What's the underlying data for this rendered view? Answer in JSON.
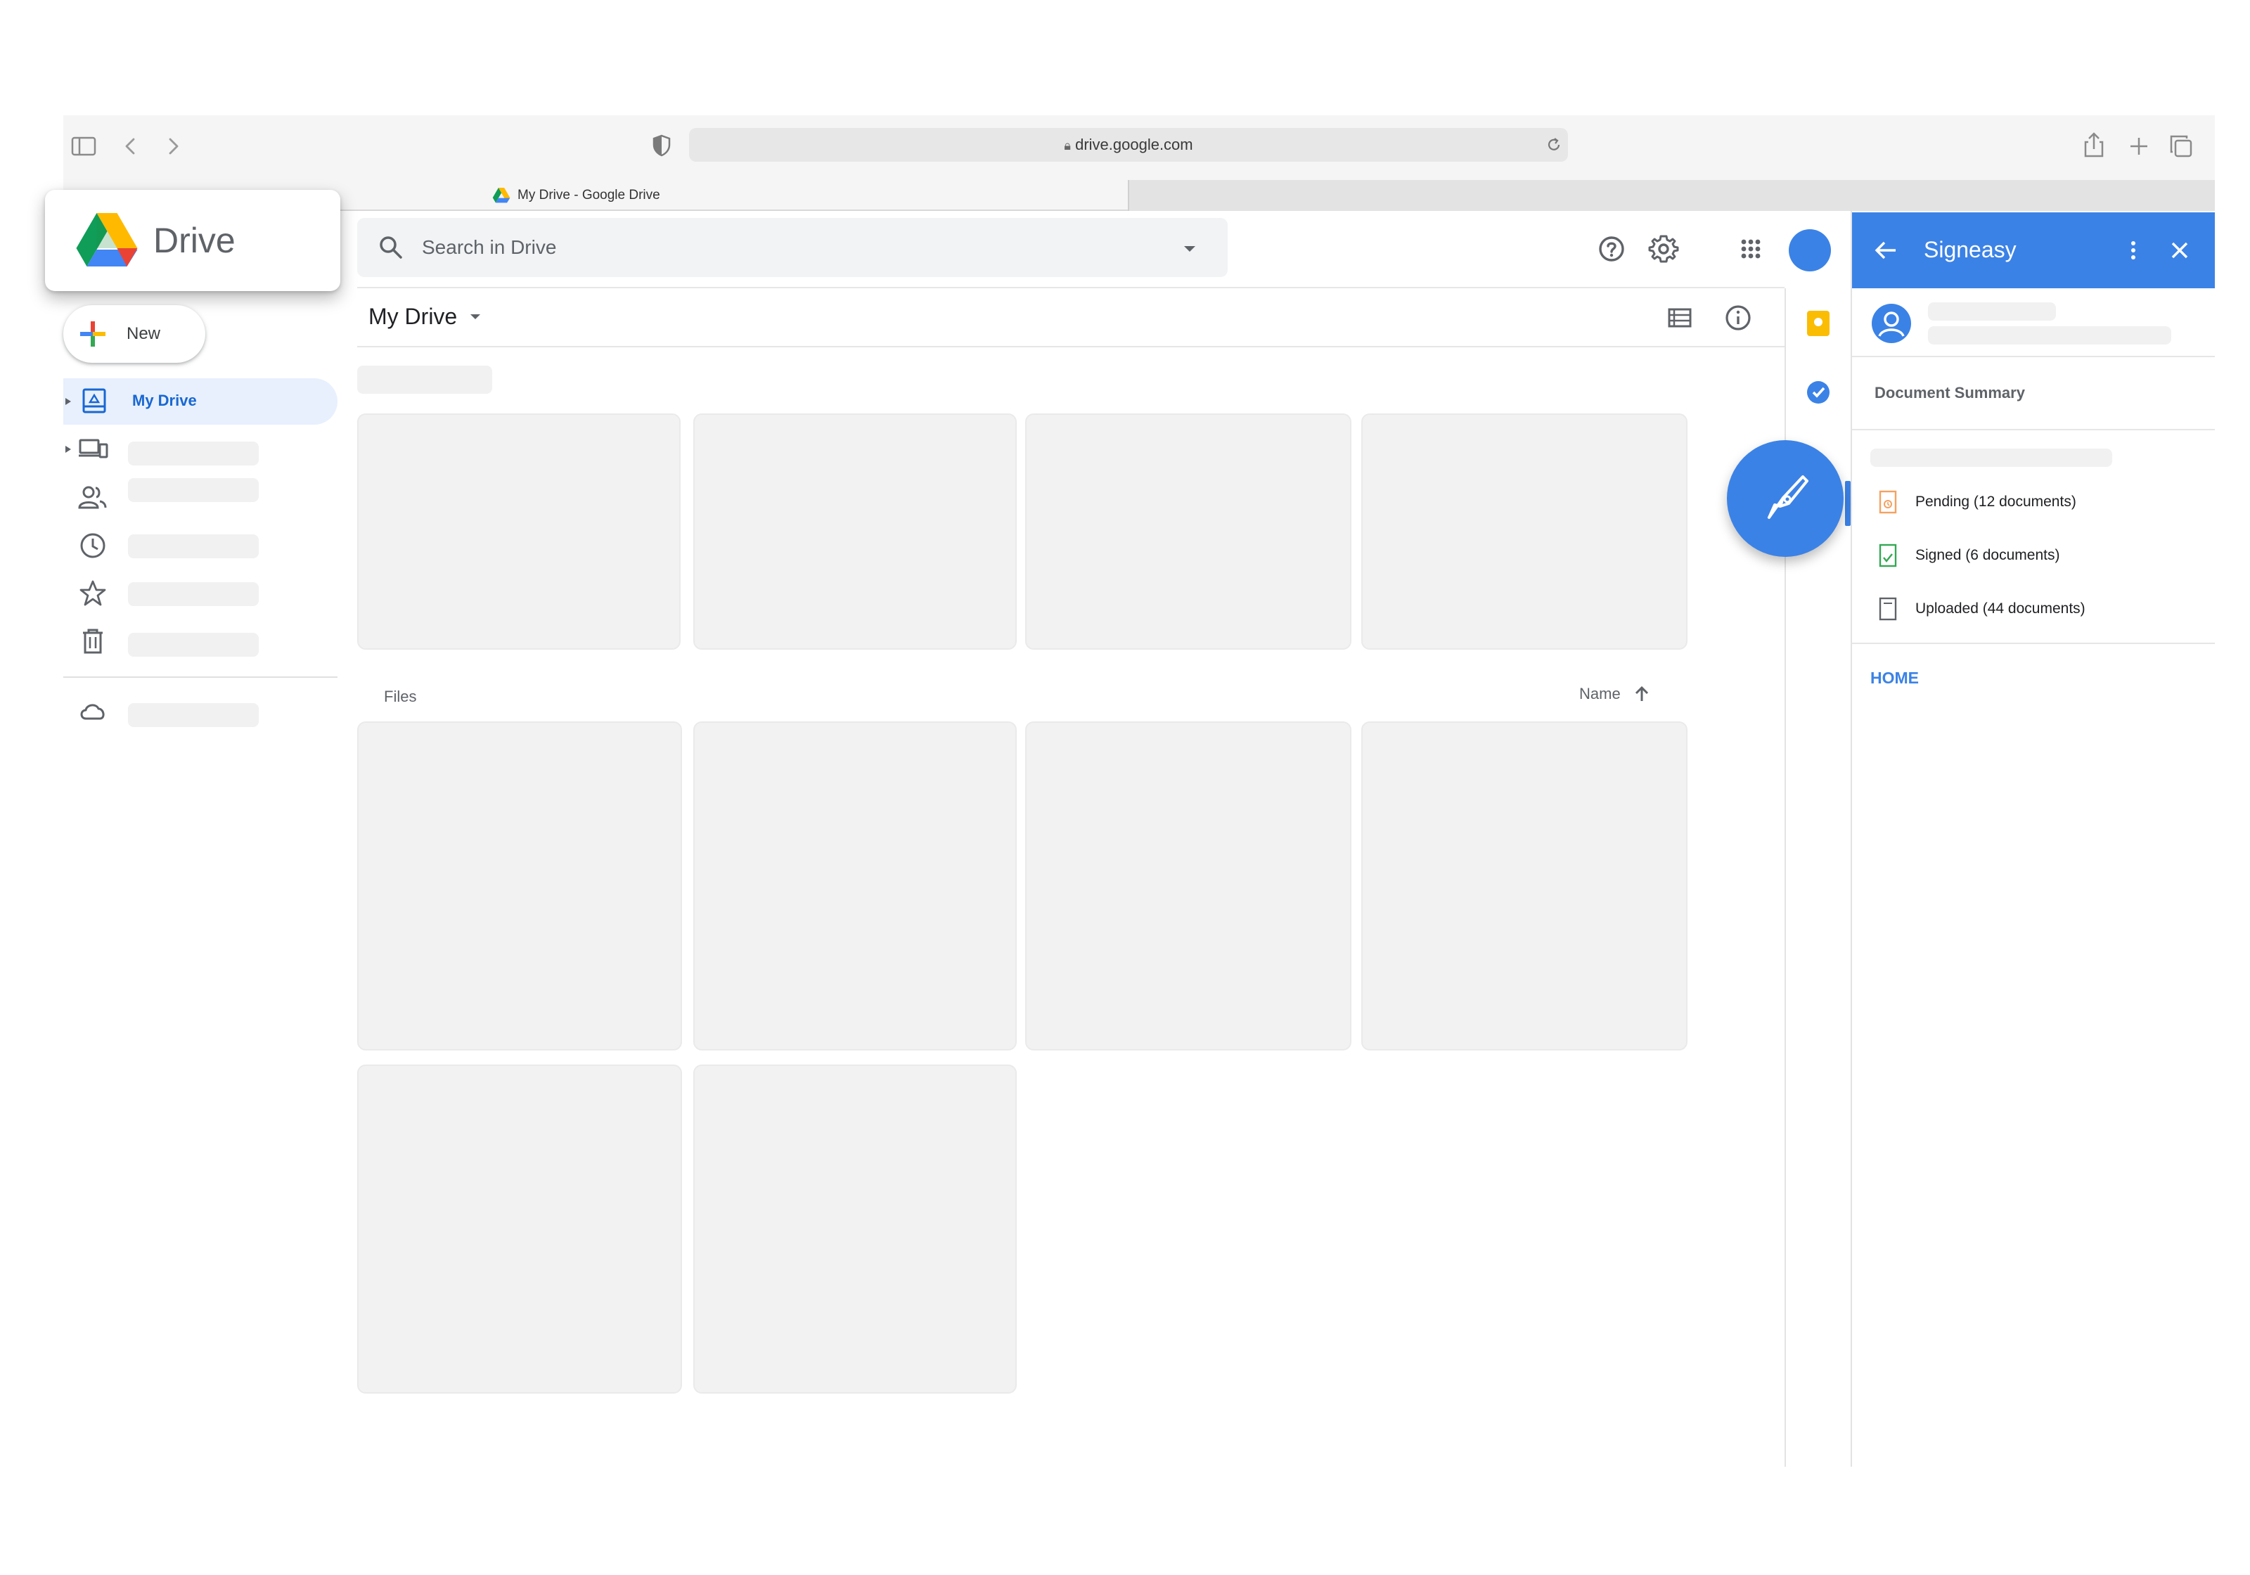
{
  "browser": {
    "url": "drive.google.com",
    "tab_title": "My Drive - Google Drive"
  },
  "app": {
    "logo_label": "Drive",
    "new_button_label": "New"
  },
  "search": {
    "placeholder": "Search in Drive"
  },
  "main": {
    "title": "My Drive",
    "files_label": "Files",
    "sort_label": "Name"
  },
  "sidebar": {
    "items": [
      {
        "label": "My Drive",
        "icon": "my-drive-icon",
        "selected": true
      }
    ]
  },
  "panel": {
    "title": "Signeasy",
    "document_summary_label": "Document Summary",
    "statuses": [
      {
        "label": "Pending (12 documents)",
        "icon": "pending-document-icon",
        "color": "#f4a261"
      },
      {
        "label": "Signed (6 documents)",
        "icon": "signed-document-icon",
        "color": "#34a853"
      },
      {
        "label": "Uploaded (44 documents)",
        "icon": "uploaded-document-icon",
        "color": "#5f6368"
      }
    ],
    "home_label": "HOME"
  },
  "colors": {
    "accent": "#3b82e6",
    "selected_bg": "#e8f0fe",
    "skeleton": "#f1f2f1"
  }
}
